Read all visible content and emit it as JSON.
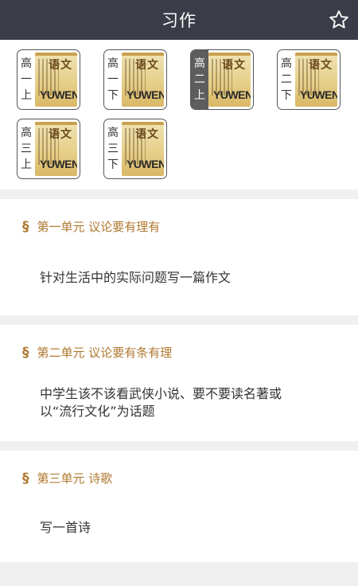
{
  "header": {
    "title": "习作",
    "star_icon": "star-outline-icon"
  },
  "books": [
    {
      "label": [
        "高",
        "一",
        "上"
      ],
      "cover_title": "语文",
      "cover_word": "YUWEN",
      "selected": false
    },
    {
      "label": [
        "高",
        "一",
        "下"
      ],
      "cover_title": "语文",
      "cover_word": "YUWEN",
      "selected": false
    },
    {
      "label": [
        "高",
        "二",
        "上"
      ],
      "cover_title": "语文",
      "cover_word": "YUWEN",
      "selected": true
    },
    {
      "label": [
        "高",
        "二",
        "下"
      ],
      "cover_title": "语文",
      "cover_word": "YUWEN",
      "selected": false
    },
    {
      "label": [
        "高",
        "三",
        "上"
      ],
      "cover_title": "语文",
      "cover_word": "YUWEN",
      "selected": false
    },
    {
      "label": [
        "高",
        "三",
        "下"
      ],
      "cover_title": "语文",
      "cover_word": "YUWEN",
      "selected": false
    }
  ],
  "units": [
    {
      "section_icon": "§",
      "title": "第一单元 议论要有理有",
      "lines": [
        "针对生活中的实际问题写一篇作文"
      ]
    },
    {
      "section_icon": "§",
      "title": "第二单元 议论要有条有理",
      "lines": [
        "中学生该不该看武侠小说、要不要读名著或",
        "以“流行文化”为话题"
      ]
    },
    {
      "section_icon": "§",
      "title": "第三单元 诗歌",
      "lines": [
        "写一首诗"
      ]
    }
  ],
  "colors": {
    "header_bg": "#3a3d48",
    "accent": "#b07930",
    "selected_label_bg": "#5d5d5d"
  }
}
